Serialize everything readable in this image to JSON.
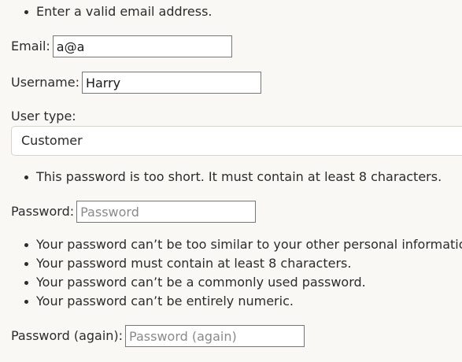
{
  "email_errors": [
    "Enter a valid email address."
  ],
  "email": {
    "label": "Email:",
    "value": "a@a"
  },
  "username": {
    "label": "Username:",
    "value": "Harry"
  },
  "user_type": {
    "label": "User type:",
    "selected": "Customer"
  },
  "password_errors": [
    "This password is too short. It must contain at least 8 characters."
  ],
  "password": {
    "label": "Password:",
    "placeholder": "Password",
    "value": ""
  },
  "password_help": [
    "Your password can’t be too similar to your other personal information.",
    "Your password must contain at least 8 characters.",
    "Your password can’t be a commonly used password.",
    "Your password can’t be entirely numeric."
  ],
  "password2": {
    "label": "Password (again):",
    "placeholder": "Password (again)",
    "value": ""
  }
}
